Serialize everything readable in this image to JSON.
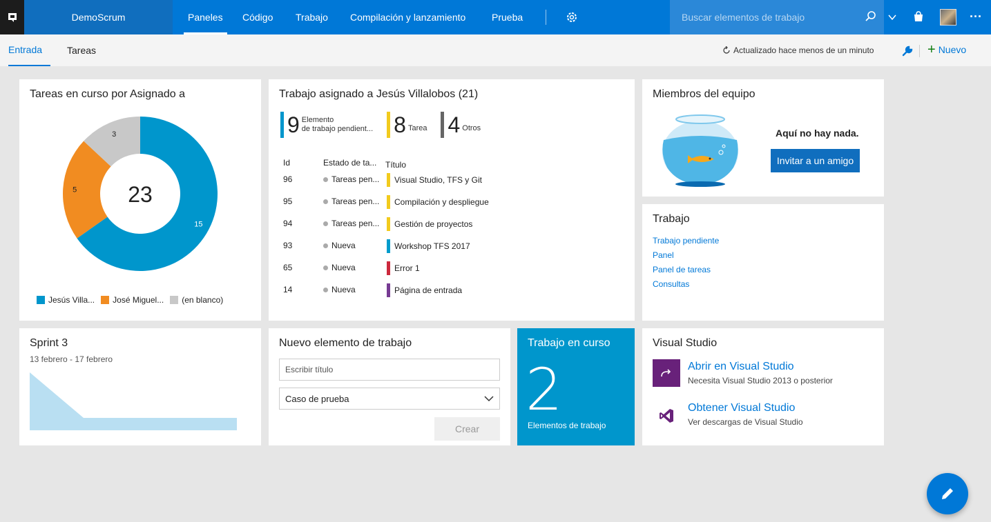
{
  "colors": {
    "brand": "#0078d7",
    "teal": "#0096cc",
    "orange": "#f18c21",
    "gray": "#c8c8c8",
    "task": "#f2cb1d",
    "pbi": "#009ccc",
    "bug": "#cc293d",
    "feature": "#773b93"
  },
  "header": {
    "project": "DemoScrum",
    "nav": [
      "Paneles",
      "Código",
      "Trabajo",
      "Compilación y lanzamiento",
      "Prueba"
    ],
    "search_placeholder": "Buscar elementos de trabajo",
    "icons": [
      "settings-gear-icon",
      "search-icon",
      "chevron-down-icon",
      "marketplace-bag-icon",
      "more-icon"
    ]
  },
  "subnav": {
    "tabs": [
      "Entrada",
      "Tareas"
    ],
    "refresh": "Actualizado hace menos de un minuto",
    "new_label": "Nuevo"
  },
  "donut": {
    "title": "Tareas en curso por Asignado a",
    "total": "23",
    "legend": [
      "Jesús Villa...",
      "José Miguel...",
      "(en blanco)"
    ]
  },
  "chart_data": {
    "type": "pie",
    "title": "Tareas en curso por Asignado a",
    "categories": [
      "Jesús Villa...",
      "José Miguel...",
      "(en blanco)"
    ],
    "values": [
      15,
      5,
      3
    ],
    "colors": [
      "#0096cc",
      "#f18c21",
      "#c8c8c8"
    ],
    "donut_center_label": "23",
    "legend": "bottom"
  },
  "assigned": {
    "title": "Trabajo asignado a Jesús Villalobos (21)",
    "counts": [
      {
        "num": "9",
        "label1": "Elemento",
        "label2": "de trabajo pendient...",
        "color": "#0096cc"
      },
      {
        "num": "8",
        "label1": "Tarea",
        "label2": "",
        "color": "#f2cb1d"
      },
      {
        "num": "4",
        "label1": "Otros",
        "label2": "",
        "color": "#666666"
      }
    ],
    "headers": {
      "id": "Id",
      "state": "Estado de ta...",
      "title": "Título"
    },
    "rows": [
      {
        "id": "96",
        "state": "Tareas pen...",
        "title": "Visual Studio, TFS y Git",
        "color": "#f2cb1d"
      },
      {
        "id": "95",
        "state": "Tareas pen...",
        "title": "Compilación y despliegue",
        "color": "#f2cb1d"
      },
      {
        "id": "94",
        "state": "Tareas pen...",
        "title": "Gestión de proyectos",
        "color": "#f2cb1d"
      },
      {
        "id": "93",
        "state": "Nueva",
        "title": "Workshop TFS 2017",
        "color": "#009ccc"
      },
      {
        "id": "65",
        "state": "Nueva",
        "title": "Error 1",
        "color": "#cc293d"
      },
      {
        "id": "14",
        "state": "Nueva",
        "title": "Página de entrada",
        "color": "#773b93"
      }
    ]
  },
  "team": {
    "title": "Miembros del equipo",
    "empty": "Aquí no hay nada.",
    "invite": "Invitar a un amigo"
  },
  "work": {
    "title": "Trabajo",
    "links": [
      "Trabajo pendiente",
      "Panel",
      "Panel de tareas",
      "Consultas"
    ]
  },
  "sprint": {
    "title": "Sprint 3",
    "dates": "13 febrero - 17 febrero"
  },
  "newitem": {
    "title": "Nuevo elemento de trabajo",
    "placeholder": "Escribir título",
    "type": "Caso de prueba",
    "create": "Crear"
  },
  "wip": {
    "title": "Trabajo en curso",
    "value": "2",
    "label": "Elementos de trabajo"
  },
  "vs": {
    "title": "Visual Studio",
    "open": "Abrir en Visual Studio",
    "open_desc": "Necesita Visual Studio 2013 o posterior",
    "get": "Obtener Visual Studio",
    "get_desc": "Ver descargas de Visual Studio"
  }
}
